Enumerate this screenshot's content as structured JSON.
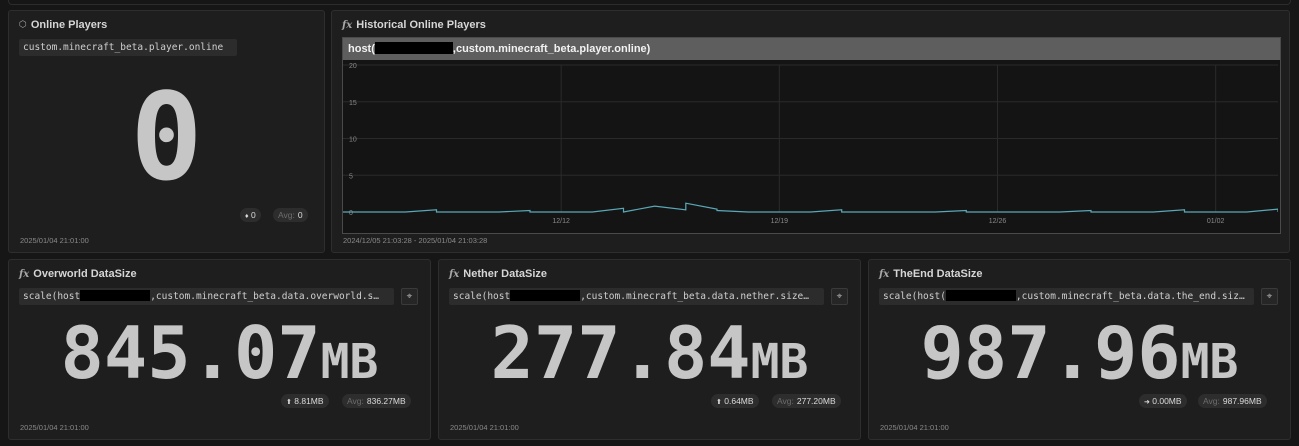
{
  "online": {
    "title": "Online Players",
    "icon": "cube-icon",
    "query": "custom.minecraft_beta.player.online",
    "value": "0",
    "delta": "0",
    "avg_label": "Avg:",
    "avg": "0",
    "timestamp": "2025/01/04 21:01:00"
  },
  "history": {
    "title": "Historical Online Players",
    "icon": "function-icon",
    "legend_prefix": "host(",
    "legend_suffix": ",custom.minecraft_beta.player.online)",
    "time_range": "2024/12/05 21:03:28 - 2025/01/04 21:03:28"
  },
  "overworld": {
    "title": "Overworld DataSize",
    "icon": "function-icon",
    "query_prefix": "scale(host",
    "query_suffix": ",custom.minecraft_beta.data.overworld.s…",
    "value": "845.07",
    "unit": "MB",
    "delta": "8.81MB",
    "avg_label": "Avg:",
    "avg": "836.27MB",
    "timestamp": "2025/01/04 21:01:00"
  },
  "nether": {
    "title": "Nether DataSize",
    "icon": "function-icon",
    "query_prefix": "scale(host",
    "query_suffix": ",custom.minecraft_beta.data.nether.size…",
    "value": "277.84",
    "unit": "MB",
    "delta": "0.64MB",
    "avg_label": "Avg:",
    "avg": "277.20MB",
    "timestamp": "2025/01/04 21:01:00"
  },
  "theend": {
    "title": "TheEnd DataSize",
    "icon": "function-icon",
    "query_prefix": "scale(host(",
    "query_suffix": ",custom.minecraft_beta.data.the_end.siz…",
    "value": "987.96",
    "unit": "MB",
    "delta": "0.00MB",
    "avg_label": "Avg:",
    "avg": "987.96MB",
    "timestamp": "2025/01/04 21:01:00"
  },
  "colors": {
    "background": "#161616",
    "panel": "#1e1e1e",
    "series": "#5aa8b8"
  },
  "chart_data": {
    "type": "line",
    "title": "",
    "xlabel": "",
    "ylabel": "",
    "ylim": [
      0,
      20
    ],
    "yticks": [
      "5",
      "10",
      "15",
      "20"
    ],
    "y_zero_label": "0",
    "xticks": [
      "12/12",
      "12/19",
      "12/26",
      "01/02"
    ],
    "xtick_dates": [
      "2024-12-12",
      "2024-12-19",
      "2024-12-26",
      "2025-01-02"
    ],
    "x_range": [
      "2024-12-05",
      "2025-01-04"
    ],
    "grid": true,
    "series": [
      {
        "values": [
          [
            "2024-12-05",
            0
          ],
          [
            "2024-12-07",
            0
          ],
          [
            "2024-12-08",
            0.3
          ],
          [
            "2024-12-08",
            0
          ],
          [
            "2024-12-10",
            0
          ],
          [
            "2024-12-11",
            0.2
          ],
          [
            "2024-12-11",
            0
          ],
          [
            "2024-12-13",
            0
          ],
          [
            "2024-12-14",
            0.5
          ],
          [
            "2024-12-14",
            0
          ],
          [
            "2024-12-15",
            0.8
          ],
          [
            "2024-12-16",
            0.3
          ],
          [
            "2024-12-16",
            1.2
          ],
          [
            "2024-12-17",
            0.4
          ],
          [
            "2024-12-17",
            0.2
          ],
          [
            "2024-12-18",
            0
          ],
          [
            "2024-12-20",
            0
          ],
          [
            "2024-12-21",
            0.3
          ],
          [
            "2024-12-21",
            0
          ],
          [
            "2024-12-24",
            0
          ],
          [
            "2024-12-25",
            0.2
          ],
          [
            "2024-12-25",
            0
          ],
          [
            "2024-12-28",
            0
          ],
          [
            "2024-12-29",
            0.2
          ],
          [
            "2024-12-29",
            0
          ],
          [
            "2024-12-31",
            0
          ],
          [
            "2025-01-01",
            0.3
          ],
          [
            "2025-01-01",
            0
          ],
          [
            "2025-01-03",
            0
          ],
          [
            "2025-01-04",
            0.4
          ],
          [
            "2025-01-04",
            0
          ]
        ]
      }
    ]
  }
}
